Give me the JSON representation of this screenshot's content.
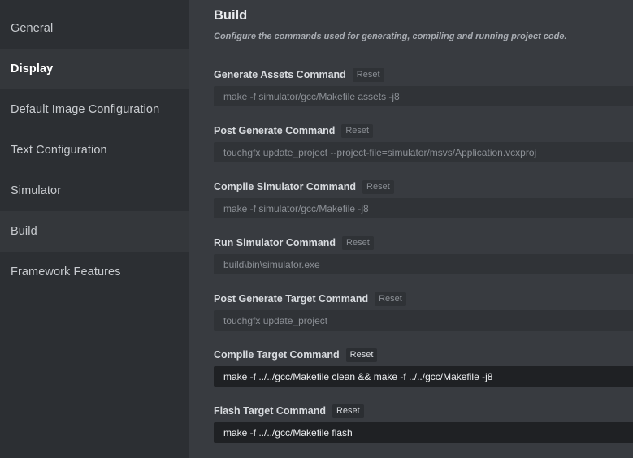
{
  "sidebar": {
    "items": [
      {
        "label": "General"
      },
      {
        "label": "Display"
      },
      {
        "label": "Default Image Configuration"
      },
      {
        "label": "Text Configuration"
      },
      {
        "label": "Simulator"
      },
      {
        "label": "Build"
      },
      {
        "label": "Framework Features"
      }
    ]
  },
  "main": {
    "title": "Build",
    "description": "Configure the commands used for generating, compiling and running project code.",
    "fields": [
      {
        "label": "Generate Assets Command",
        "reset_label": "Reset",
        "value": "make -f simulator/gcc/Makefile assets -j8"
      },
      {
        "label": "Post Generate Command",
        "reset_label": "Reset",
        "value": "touchgfx update_project --project-file=simulator/msvs/Application.vcxproj"
      },
      {
        "label": "Compile Simulator Command",
        "reset_label": "Reset",
        "value": "make -f simulator/gcc/Makefile -j8"
      },
      {
        "label": "Run Simulator Command",
        "reset_label": "Reset",
        "value": "build\\bin\\simulator.exe"
      },
      {
        "label": "Post Generate Target Command",
        "reset_label": "Reset",
        "value": "touchgfx update_project"
      },
      {
        "label": "Compile Target Command",
        "reset_label": "Reset",
        "value": "make -f ../../gcc/Makefile clean && make -f ../../gcc/Makefile -j8"
      },
      {
        "label": "Flash Target Command",
        "reset_label": "Reset",
        "value": "make -f ../../gcc/Makefile flash"
      }
    ]
  },
  "colors": {
    "sidebar_bg": "#2c2f33",
    "main_bg": "#383b40",
    "input_default_bg": "#303337",
    "input_custom_bg": "#1f2124"
  }
}
